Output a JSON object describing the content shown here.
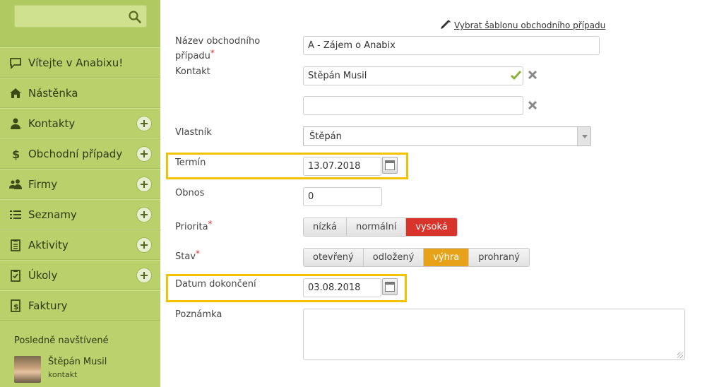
{
  "search": {
    "placeholder": ""
  },
  "sidebar": {
    "items": [
      {
        "label": "Vítejte v Anabixu!",
        "icon": "chat-bubble-icon",
        "plus": false
      },
      {
        "label": "Nástěnka",
        "icon": "home-icon",
        "plus": false
      },
      {
        "label": "Kontakty",
        "icon": "person-icon",
        "plus": true
      },
      {
        "label": "Obchodní případy",
        "icon": "dollar-icon",
        "plus": true
      },
      {
        "label": "Firmy",
        "icon": "people-icon",
        "plus": true
      },
      {
        "label": "Seznamy",
        "icon": "list-icon",
        "plus": true
      },
      {
        "label": "Aktivity",
        "icon": "clipboard-icon",
        "plus": true
      },
      {
        "label": "Úkoly",
        "icon": "checklist-icon",
        "plus": true
      },
      {
        "label": "Faktury",
        "icon": "invoice-icon",
        "plus": false
      }
    ],
    "recent_title": "Posledně navštívené",
    "recent": {
      "name": "Štěpán Musil",
      "type": "kontakt"
    }
  },
  "form": {
    "template_link": "Vybrat šablonu obchodního případu",
    "name_label": "Název obchodního případu",
    "name_value": "A - Zájem o Anabix",
    "contact_label": "Kontakt",
    "contact_value": "Štěpán Musil",
    "contact_value2": "",
    "owner_label": "Vlastník",
    "owner_value": "Štěpán",
    "deadline_label": "Termín",
    "deadline_value": "13.07.2018",
    "amount_label": "Obnos",
    "amount_value": "0",
    "priority_label": "Priorita",
    "priority_options": [
      "nízká",
      "normální",
      "vysoká"
    ],
    "priority_selected": "vysoká",
    "status_label": "Stav",
    "status_options": [
      "otevřený",
      "odložený",
      "výhra",
      "prohraný"
    ],
    "status_selected": "výhra",
    "completion_label": "Datum dokončení",
    "completion_value": "03.08.2018",
    "note_label": "Poznámka",
    "note_value": ""
  },
  "colors": {
    "sidebar_bg": "#b7cf6a",
    "priority_active": "#d9342b",
    "status_active": "#e8a21a",
    "highlight": "#f2c200"
  }
}
